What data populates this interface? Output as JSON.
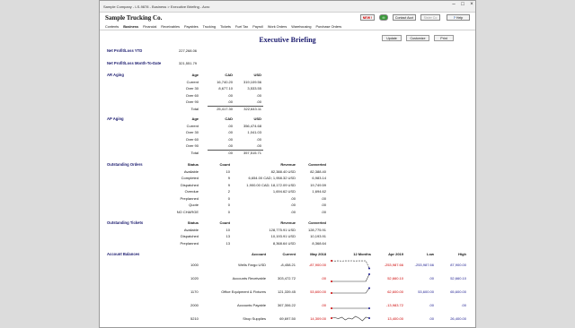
{
  "window": {
    "title": "Sample Company - LS-9878 - Business > Executive Briefing - Acro"
  },
  "header": {
    "company": "Sample Trucking Co.",
    "new_label": "NEW !",
    "contact_label": "Contact Acct",
    "sister_label": "Sister Co",
    "help_label": "Help"
  },
  "menu": [
    "Contents",
    "Business",
    "Financial",
    "Receivables",
    "Payables",
    "Trucking",
    "Tickets",
    "Fuel Tax",
    "Payroll",
    "Work Orders",
    "Warehousing",
    "Purchase Orders"
  ],
  "page": {
    "title": "Executive Briefing",
    "update": "Update",
    "customize": "Customize",
    "print": "Print"
  },
  "net": {
    "ytd_label": "Net Profit/Loss YTD",
    "ytd_value": "227,268.06",
    "mtd_label": "Net Profit/Loss Month-To-Date",
    "mtd_value": "321,551.79"
  },
  "ar": {
    "title": "AR Aging",
    "headers": [
      "Age",
      "CAD",
      "USD"
    ],
    "rows": [
      [
        "Current",
        "16,740.20",
        "319,109.56"
      ],
      [
        "Over 30",
        "8,677.10",
        "3,533.55"
      ],
      [
        "Over 60",
        ".00",
        ".00"
      ],
      [
        "Over 90",
        ".00",
        ".00"
      ],
      [
        "Total",
        "25,417.30",
        "322,643.11"
      ]
    ]
  },
  "ap": {
    "title": "AP Aging",
    "headers": [
      "Age",
      "CAD",
      "USD"
    ],
    "rows": [
      [
        "Current",
        ".00",
        "356,474.68"
      ],
      [
        "Over 30",
        ".00",
        "1,041.03"
      ],
      [
        "Over 60",
        ".00",
        ".00"
      ],
      [
        "Over 90",
        ".00",
        ".00"
      ],
      [
        "Total",
        ".00",
        "357,515.71"
      ]
    ]
  },
  "orders": {
    "title": "Outstanding Orders",
    "headers": [
      "Status",
      "Count",
      "Revenue",
      "Converted"
    ],
    "rows": [
      [
        "Available",
        "10",
        "82,388.40 USD",
        "82,388.40"
      ],
      [
        "Completed",
        "9",
        "6,654.00 CAD; 1,958.32 USD",
        "6,983.14"
      ],
      [
        "Dispatched",
        "9",
        "1,900.00 CAD; 18,172.09 USD",
        "19,749.59"
      ],
      [
        "Overdue",
        "2",
        "1,694.62 USD",
        "1,694.62"
      ],
      [
        "Preplanned",
        "0",
        ".00",
        ".00"
      ],
      [
        "Quote",
        "0",
        ".00",
        ".00"
      ],
      [
        "NO CHARGE",
        "0",
        ".00",
        ".00"
      ]
    ]
  },
  "tickets": {
    "title": "Outstanding Tickets",
    "headers": [
      "Status",
      "Count",
      "Revenue",
      "Converted"
    ],
    "rows": [
      [
        "Available",
        "10",
        "128,775.91 USD",
        "128,775.91"
      ],
      [
        "Dispatched",
        "13",
        "10,193.91 USD",
        "10,193.91"
      ],
      [
        "Preplanned",
        "13",
        "8,368.64 USD",
        "8,368.64"
      ]
    ]
  },
  "balances": {
    "title": "Account Balances",
    "headers": [
      "Account",
      "Current",
      "May 2018",
      "12 Months",
      "Apr 2019",
      "Low",
      "High"
    ],
    "rows": [
      {
        "num": "1000",
        "account": "Wells Fargo USD",
        "current": "-8,458.21",
        "may": "-87,900.00",
        "apr": "-253,987.66",
        "low": "-253,987.66",
        "high": "87,900.00",
        "spark": [
          0.9,
          0.88,
          0.9,
          0.87,
          0.9,
          0.89,
          0.9,
          0.88,
          0.9,
          0.89,
          0.9,
          0.05
        ]
      },
      {
        "num": "1020",
        "account": "Accounts Receivable",
        "current": "303,472.72",
        "may": ".00",
        "apr": "52,660.10",
        "low": ".00",
        "high": "52,660.10",
        "spark": [
          0.1,
          0.1,
          0.1,
          0.1,
          0.1,
          0.1,
          0.1,
          0.1,
          0.1,
          0.1,
          0.1,
          0.9
        ]
      },
      {
        "num": "1170",
        "account": "Office Equipment & Fixtures",
        "current": "121,339.45",
        "may": "53,600.00",
        "apr": "62,600.00",
        "low": "53,600.00",
        "high": "65,600.00",
        "spark": [
          0.3,
          0.3,
          0.3,
          0.3,
          0.3,
          0.3,
          0.3,
          0.3,
          0.3,
          0.3,
          0.3,
          0.85
        ]
      },
      {
        "num": "2000",
        "account": "Accounts Payable",
        "current": "367,306.22",
        "may": ".00",
        "apr": "-13,983.72",
        "low": ".00",
        "high": ".00",
        "spark": [
          0.1,
          0.1,
          0.1,
          0.1,
          0.1,
          0.1,
          0.1,
          0.1,
          0.1,
          0.1,
          0.1,
          0.1
        ]
      },
      {
        "num": "5210",
        "account": "Shop Supplies",
        "current": "69,697.50",
        "may": "14,309.00",
        "apr": "13,400.00",
        "low": ".00",
        "high": "26,400.00",
        "spark": [
          0.5,
          0.55,
          0.45,
          0.6,
          0.3,
          0.5,
          0.4,
          0.7,
          0.5,
          0.2,
          0.6,
          0.5
        ]
      }
    ]
  }
}
